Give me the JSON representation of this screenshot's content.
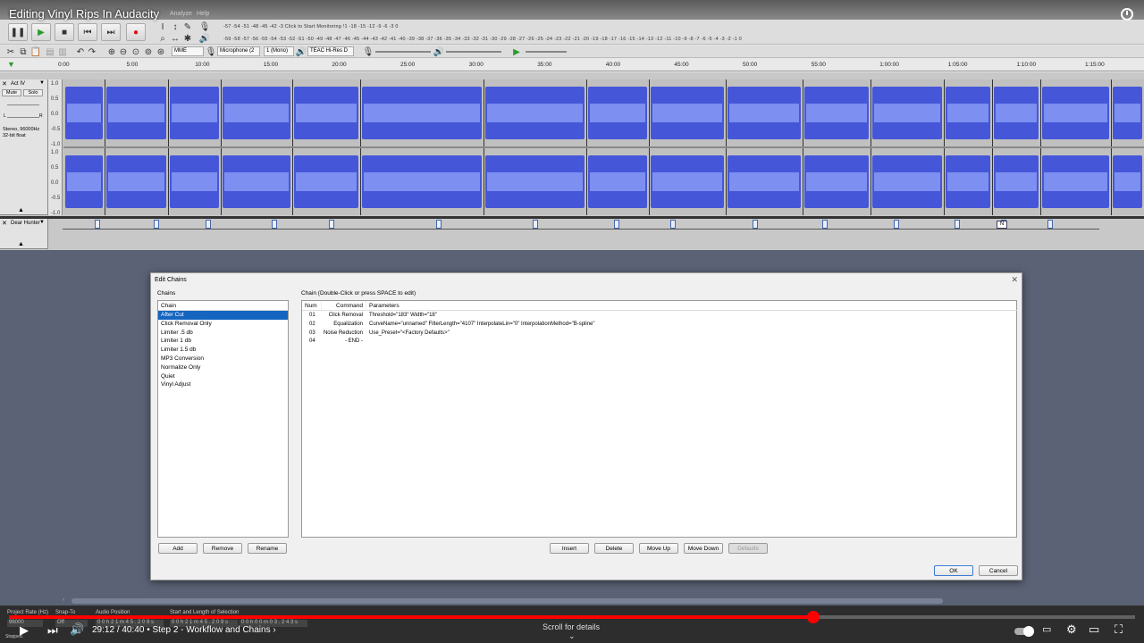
{
  "video": {
    "title": "Editing Vinyl Rips In Audacity",
    "time_current": "29:12",
    "time_total": "40:40",
    "chapter": "Step 2 - Workflow and Chains",
    "time_separator": "/",
    "chapter_separator": "•",
    "chapter_chevron": "›",
    "scroll_hint": "Scroll for details",
    "progress_fraction": 0.714
  },
  "audacity": {
    "menus": {
      "analyze": "Analyze",
      "help": "Help"
    },
    "meters": {
      "record_scale": "-57 -54 -51 -48 -45 -42 -3 Click to Start Monitoring !1 -18 -15 -12 -9 -6 -3 0",
      "playback_scale": "-59 -58 -57 -56 -55 -54 -53 -52 -51 -50 -49 -48 -47 -46 -45 -44 -43 -42 -41 -40 -39 -38 -37 -36 -35 -34 -33 -32 -31 -30 -29 -28 -27 -26 -25 -24 -23 -22 -21 -20 -19 -18 -17 -16 -15 -14 -13 -12 -11 -10 -9 -8 -7 -6 -5 -4 -3 -2 -1 0"
    },
    "devices": {
      "host": "MME",
      "recording_device": "Microphone (2",
      "channels": "1 (Mono)",
      "playback_device": "TEAC Hi-Res D"
    },
    "ruler_ticks": [
      "0:00",
      "5:00",
      "10:00",
      "15:00",
      "20:00",
      "25:00",
      "30:00",
      "35:00",
      "40:00",
      "45:00",
      "50:00",
      "55:00",
      "1:00:00",
      "1:05:00",
      "1:10:00",
      "1:15:00"
    ],
    "tracks": {
      "audio": {
        "name": "Act IV",
        "mute": "Mute",
        "solo": "Solo",
        "pan_left": "L",
        "pan_right": "R",
        "info_line1": "Stereo, 96000Hz",
        "info_line2": "32-bit float",
        "axis": [
          "1.0",
          "0.5",
          "0.0",
          "-0.5",
          "-1.0"
        ]
      },
      "label": {
        "name": "Dear Hunter",
        "n_label": "N"
      }
    },
    "status": {
      "project_rate_label": "Project Rate (Hz)",
      "project_rate_value": "96000",
      "snap_to_label": "Snap-To",
      "snap_to_value": "Off",
      "audio_position_label": "Audio Position",
      "audio_position_value": "0 0 h 2 1 m 4 5 . 2 0 9 s",
      "selection_label": "Start and Length of Selection",
      "selection_start": "0 0 h 2 1 m 4 5 . 2 0 9 s",
      "selection_length": "0 0 h 0 0 m 0 3 . 2 4 3 s",
      "state": "Stopped."
    }
  },
  "dialog": {
    "title": "Edit Chains",
    "chains_label": "Chains",
    "chains_header": "Chain",
    "chains": [
      "After Cut",
      "Click Removal Only",
      "Limiter .5 db",
      "Limiter 1 db",
      "Limiter 1.5 db",
      "MP3 Conversion",
      "Normalize Only",
      "Quiet",
      "Vinyl Adjust"
    ],
    "selected_chain_index": 0,
    "chain_edit_label": "Chain (Double-Click or press SPACE to edit)",
    "columns": {
      "num": "Num",
      "command": "Command",
      "parameters": "Parameters"
    },
    "rows": [
      {
        "num": "01",
        "command": "Click Removal",
        "params": "Threshold=\"183\" Width=\"18\""
      },
      {
        "num": "02",
        "command": "Equalization",
        "params": "CurveName=\"unnamed\" FilterLength=\"4107\" InterpolateLin=\"0\" InterpolationMethod=\"B-spline\""
      },
      {
        "num": "03",
        "command": "Noise Reduction",
        "params": "Use_Preset=\"<Factory Defaults>\""
      },
      {
        "num": "04",
        "command": "- END -",
        "params": ""
      }
    ],
    "buttons": {
      "add": "Add",
      "remove": "Remove",
      "rename": "Rename",
      "insert": "Insert",
      "delete": "Delete",
      "move_up": "Move Up",
      "move_down": "Move Down",
      "defaults": "Defaults",
      "ok": "OK",
      "cancel": "Cancel"
    },
    "close_glyph": "✕"
  },
  "colors": {
    "waveform": "#4557d8",
    "waveform_rms": "#7d8ff0",
    "selection": "#1565c0",
    "progress": "#ff0000"
  }
}
